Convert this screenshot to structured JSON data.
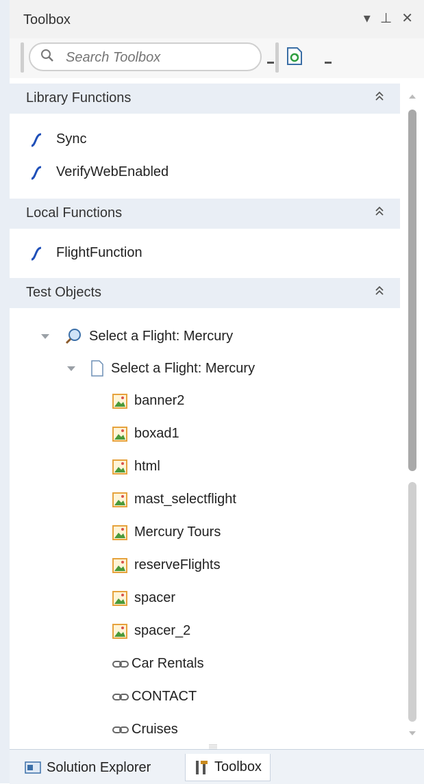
{
  "window": {
    "title": "Toolbox"
  },
  "toolbar": {
    "search_placeholder": "Search Toolbox"
  },
  "sections": [
    {
      "label": "Library Functions",
      "items": [
        "Sync",
        "VerifyWebEnabled"
      ]
    },
    {
      "label": "Local Functions",
      "items": [
        "FlightFunction"
      ]
    },
    {
      "label": "Test Objects"
    }
  ],
  "tree": {
    "browser": "Select a Flight: Mercury",
    "page": "Select a Flight: Mercury",
    "images": [
      "banner2",
      "boxad1",
      "html",
      "mast_selectflight",
      "Mercury Tours",
      "reserveFlights",
      "spacer",
      "spacer_2"
    ],
    "links": [
      "Car Rentals",
      "CONTACT",
      "Cruises"
    ]
  },
  "tabs": [
    "Solution Explorer",
    "Toolbox"
  ],
  "colors": {
    "section_bg": "#e9eef5",
    "function_icon": "#1f4fb8",
    "image_icon": "#e6a23c"
  }
}
